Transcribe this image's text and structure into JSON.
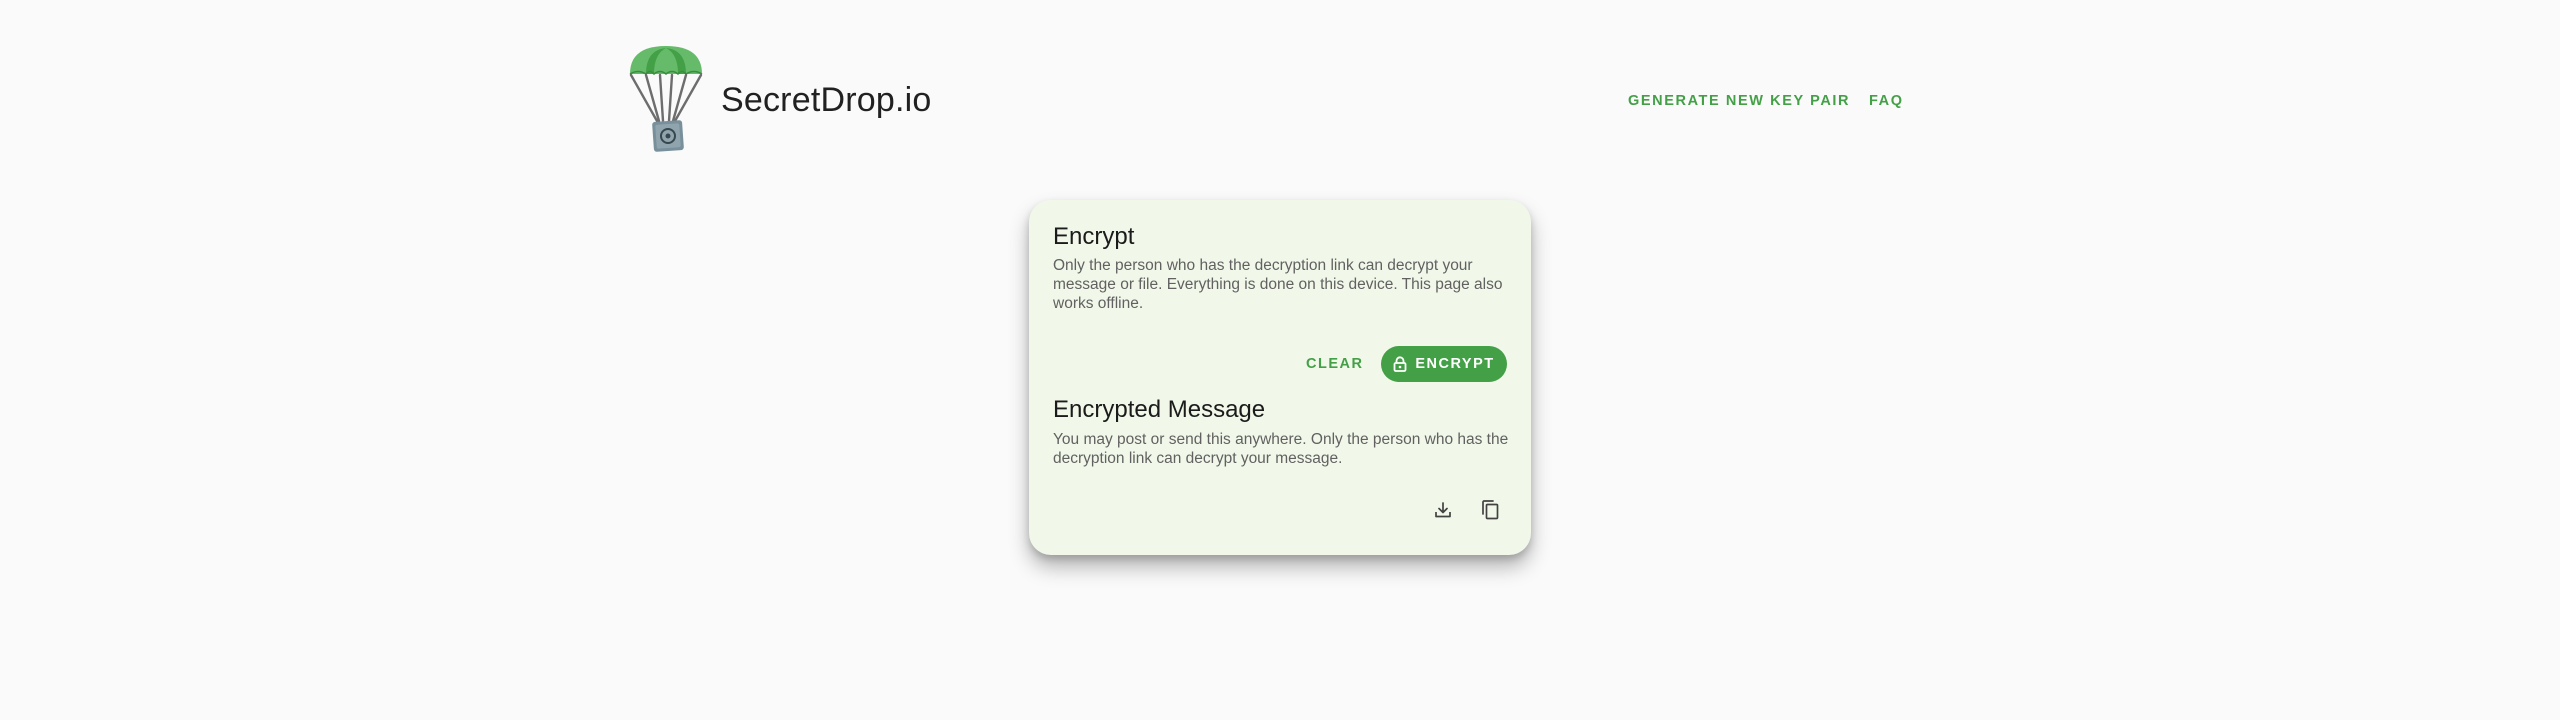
{
  "header": {
    "brand": "SecretDrop.io",
    "logo_icon": "parachute-safe-icon",
    "nav": {
      "generate_key_pair": "GENERATE NEW KEY PAIR",
      "faq": "FAQ"
    }
  },
  "encrypt_card": {
    "encrypt_section": {
      "title": "Encrypt",
      "description": "Only the person who has the decryption link can decrypt your message or file. Everything is done on this device. This page also works offline."
    },
    "actions": {
      "clear_label": "CLEAR",
      "encrypt_label": "ENCRYPT",
      "encrypt_icon": "lock-icon"
    },
    "encrypted_message_section": {
      "title": "Encrypted Message",
      "description": "You may post or send this anywhere. Only the person who has the decryption link can decrypt your message.",
      "download_icon": "download-icon",
      "copy_icon": "copy-icon"
    }
  },
  "colors": {
    "accent": "#43a047",
    "card_background": "#f1f8e9",
    "page_background": "#fafafa",
    "text_primary": "#1b1b1b",
    "text_secondary": "#616161"
  }
}
